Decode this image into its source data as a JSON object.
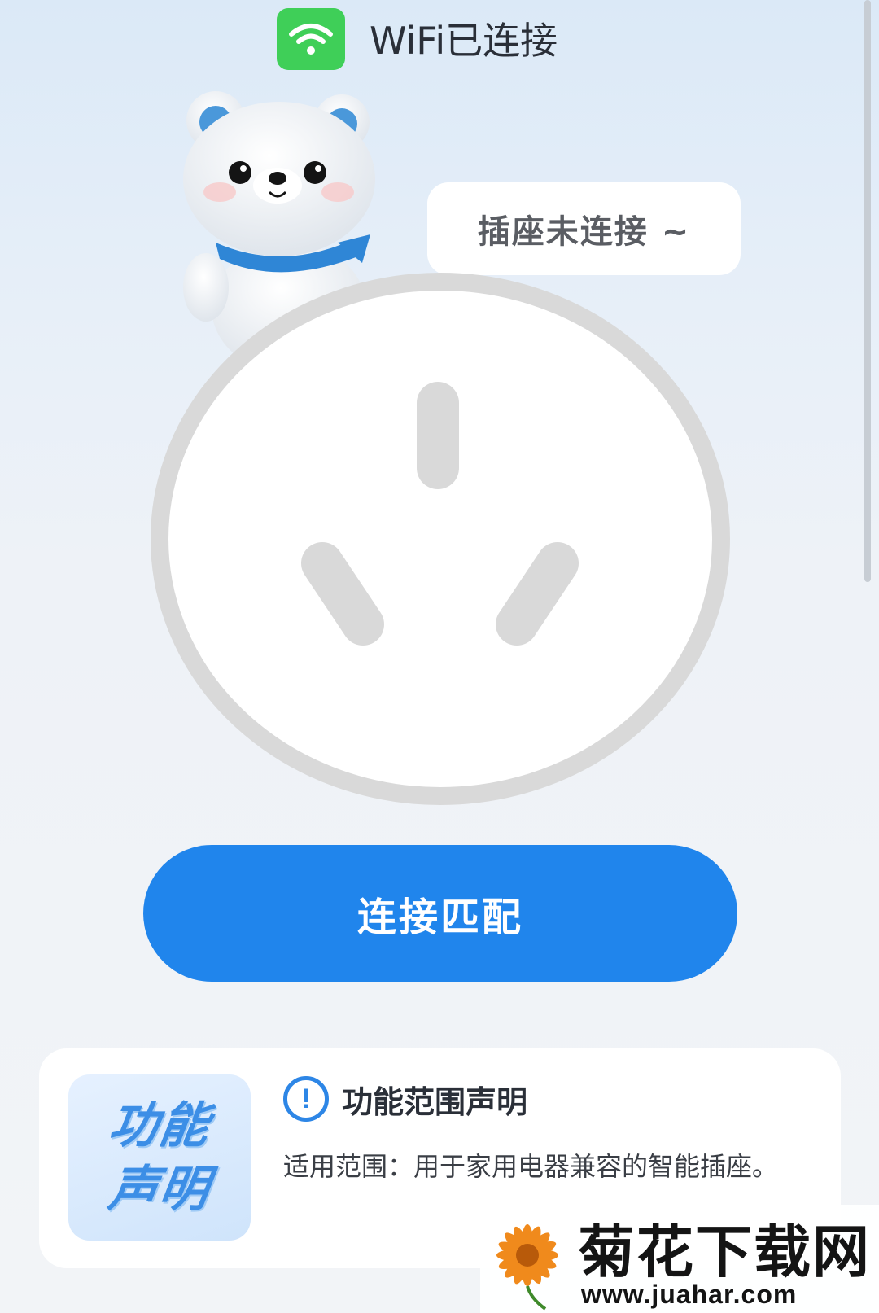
{
  "status": {
    "wifi_label": "WiFi已连接",
    "wifi_icon": "wifi-icon",
    "wifi_color": "#3fcf58"
  },
  "mascot": {
    "icon": "polar-bear-mascot"
  },
  "bubble": {
    "text": "插座未连接 ~"
  },
  "socket": {
    "icon": "power-socket-icon",
    "state": "disconnected"
  },
  "actions": {
    "connect_label": "连接匹配",
    "connect_color": "#2085ec"
  },
  "notice": {
    "badge_line1": "功能",
    "badge_line2": "声明",
    "title": "功能范围声明",
    "icon": "info-icon",
    "description": "适用范围：用于家用电器兼容的智能插座。"
  },
  "watermark": {
    "title": "菊花下载网",
    "url": "www.juahar.com",
    "icon": "chrysanthemum-flower-icon"
  }
}
